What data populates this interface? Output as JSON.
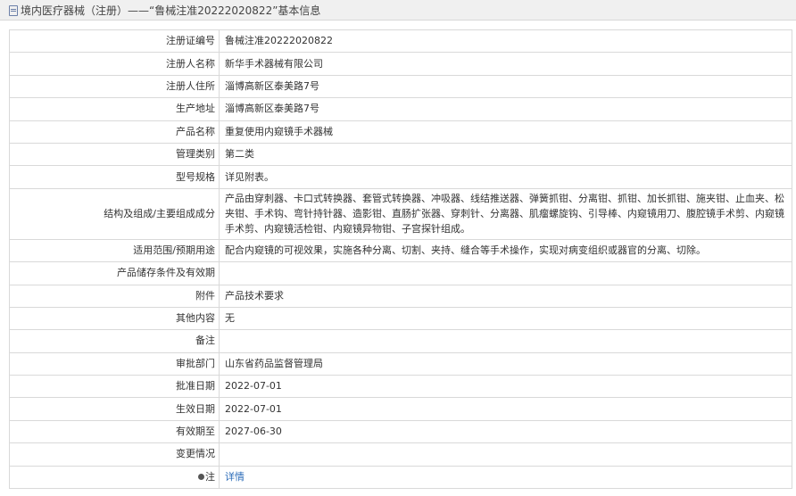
{
  "header": {
    "title": "境内医疗器械（注册）——“鲁械注准20222020822”基本信息"
  },
  "rows": [
    {
      "label": "注册证编号",
      "value": "鲁械注准20222020822"
    },
    {
      "label": "注册人名称",
      "value": "新华手术器械有限公司"
    },
    {
      "label": "注册人住所",
      "value": "淄博高新区泰美路7号"
    },
    {
      "label": "生产地址",
      "value": "淄博高新区泰美路7号"
    },
    {
      "label": "产品名称",
      "value": "重复使用内窥镜手术器械"
    },
    {
      "label": "管理类别",
      "value": "第二类"
    },
    {
      "label": "型号规格",
      "value": "详见附表。"
    },
    {
      "label": "结构及组成/主要组成成分",
      "value": "产品由穿刺器、卡口式转换器、套管式转换器、冲吸器、线结推送器、弹簧抓钳、分离钳、抓钳、加长抓钳、施夹钳、止血夹、松夹钳、手术钩、弯针持针器、造影钳、直肠扩张器、穿刺针、分离器、肌瘤螺旋钩、引导棒、内窥镜用刀、腹腔镜手术剪、内窥镜手术剪、内窥镜活检钳、内窥镜异物钳、子宫探针组成。"
    },
    {
      "label": "适用范围/预期用途",
      "value": "配合内窥镜的可视效果，实施各种分离、切割、夹持、缝合等手术操作，实现对病变组织或器官的分离、切除。"
    },
    {
      "label": "产品储存条件及有效期",
      "value": ""
    },
    {
      "label": "附件",
      "value": "产品技术要求"
    },
    {
      "label": "其他内容",
      "value": "无"
    },
    {
      "label": "备注",
      "value": ""
    },
    {
      "label": "审批部门",
      "value": "山东省药品监督管理局"
    },
    {
      "label": "批准日期",
      "value": "2022-07-01"
    },
    {
      "label": "生效日期",
      "value": "2022-07-01"
    },
    {
      "label": "有效期至",
      "value": "2027-06-30"
    },
    {
      "label": "变更情况",
      "value": ""
    }
  ],
  "note_row": {
    "label": "注",
    "link_text": "详情"
  },
  "colors": {
    "border": "#d9d9d9",
    "header_bg": "#f0f0f0",
    "link": "#2a6bb8"
  }
}
